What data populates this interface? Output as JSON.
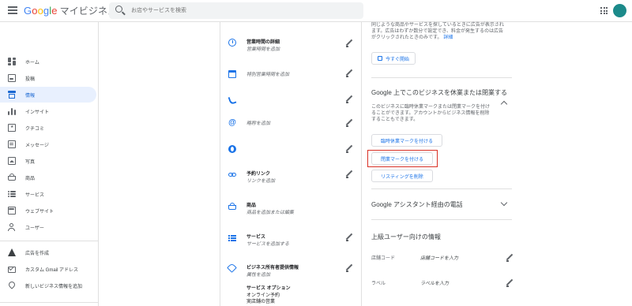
{
  "header": {
    "logo_google": [
      "G",
      "o",
      "o",
      "g",
      "l",
      "e"
    ],
    "logo_suffix": "マイビジネス",
    "search_placeholder": "お店やサービスを検索"
  },
  "sidebar": {
    "items": [
      {
        "label": "ホーム",
        "icon": "dashboard-icon"
      },
      {
        "label": "投稿",
        "icon": "post-icon"
      },
      {
        "label": "情報",
        "icon": "store-icon",
        "active": true
      },
      {
        "label": "インサイト",
        "icon": "bar-chart-icon"
      },
      {
        "label": "クチコミ",
        "icon": "review-icon"
      },
      {
        "label": "メッセージ",
        "icon": "message-icon"
      },
      {
        "label": "写真",
        "icon": "photo-icon"
      },
      {
        "label": "商品",
        "icon": "basket-icon"
      },
      {
        "label": "サービス",
        "icon": "services-icon"
      },
      {
        "label": "ウェブサイト",
        "icon": "website-icon"
      },
      {
        "label": "ユーザー",
        "icon": "add-user-icon"
      }
    ],
    "bottom_items": [
      {
        "label": "広告を作成",
        "icon": "ads-icon"
      },
      {
        "label": "カスタム Gmail アドレス",
        "icon": "mail-icon"
      },
      {
        "label": "新しいビジネス情報を追加",
        "icon": "location-pin-icon"
      }
    ]
  },
  "info_rows": [
    {
      "title": "営業時間の詳細",
      "sub": "営業時間を追加",
      "icon": "clock-plus-icon"
    },
    {
      "title": "",
      "sub": "特別営業時間を追加",
      "icon": "calendar-icon"
    },
    {
      "title": "",
      "sub": "",
      "icon": "phone-icon"
    },
    {
      "title": "",
      "sub": "略称を追加",
      "icon": "at-sign-icon"
    },
    {
      "title": "",
      "sub": "",
      "icon": "globe-icon"
    },
    {
      "title": "予約リンク",
      "sub": "リンクを追加",
      "icon": "link-icon"
    },
    {
      "title": "商品",
      "sub": "商品を追加または編集",
      "icon": "basket-icon"
    },
    {
      "title": "サービス",
      "sub": "サービスを追加する",
      "icon": "list-icon"
    },
    {
      "title": "ビジネス所有者提供情報",
      "sub": "属性を追加",
      "icon": "tag-icon"
    }
  ],
  "service_options": {
    "title": "サービス オプション",
    "lines": [
      "オンライン予約",
      "実店舗の営業"
    ]
  },
  "ads_panel": {
    "text_line1": "同じような商品やサービスを探しているときに広告が表示され",
    "text_line2": "ます。広告はわずか数分で設定でき、料金が発生するのは広告",
    "text_line3": "がクリックされたときのみです。",
    "details_link": "詳細",
    "start_button": "今すぐ開始"
  },
  "close_section": {
    "title": "Google 上でこのビジネスを休業または閉業する",
    "desc_line1": "このビジネスに臨時休業マークまたは閉業マークを付け",
    "desc_line2": "ることができます。アカウントからビジネス情報を削除",
    "desc_line3": "することもできます。",
    "temp_close_button": "臨時休業マークを付ける",
    "closed_button": "閉業マークを付ける",
    "remove_button": "リスティングを削除"
  },
  "assistant_section": {
    "title": "Google アシスタント経由の電話"
  },
  "advanced_section": {
    "title": "上級ユーザー向けの情報",
    "fields": [
      {
        "label": "店舗コード",
        "value": "店舗コードを入力"
      },
      {
        "label": "ラベル",
        "value": "ラベルを入力"
      }
    ]
  },
  "colors": {
    "accent": "#1a73e8",
    "active_bg": "#e8f0fe",
    "highlight": "#d93025",
    "avatar": "#1c8a8a"
  }
}
